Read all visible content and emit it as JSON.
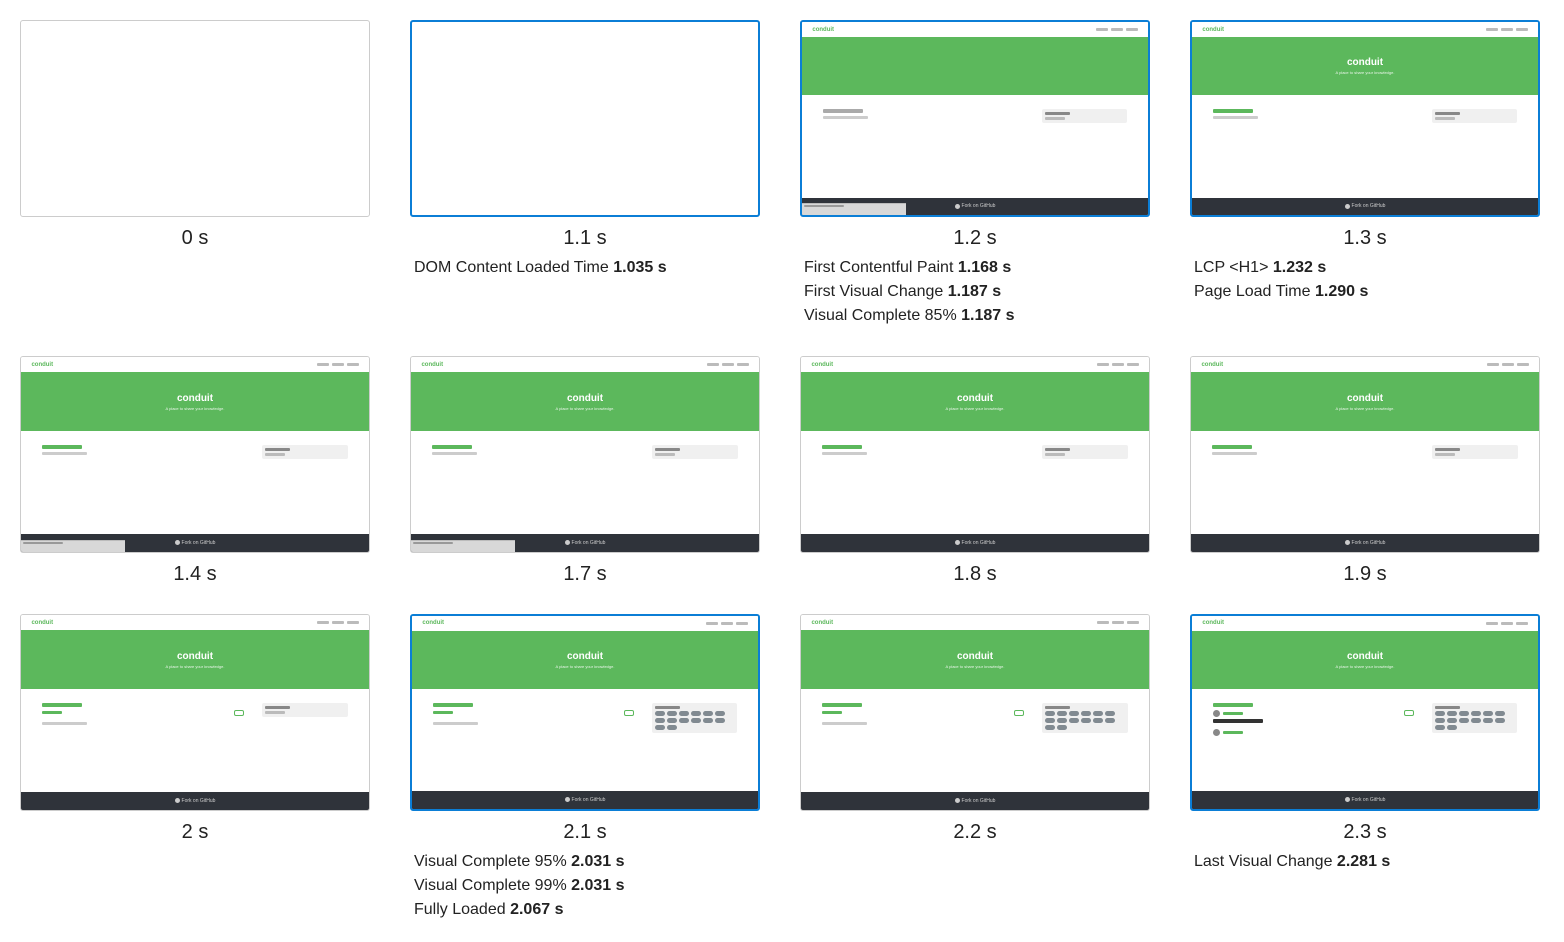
{
  "frames": [
    {
      "time": "0 s",
      "highlight": false,
      "variant": "blank",
      "metrics": []
    },
    {
      "time": "1.1 s",
      "highlight": true,
      "variant": "blank",
      "metrics": [
        {
          "label": "DOM Content Loaded Time",
          "value": "1.035 s"
        }
      ]
    },
    {
      "time": "1.2 s",
      "highlight": true,
      "variant": "partial_no_title",
      "metrics": [
        {
          "label": "First Contentful Paint",
          "value": "1.168 s"
        },
        {
          "label": "First Visual Change",
          "value": "1.187 s"
        },
        {
          "label": "Visual Complete 85%",
          "value": "1.187 s"
        }
      ]
    },
    {
      "time": "1.3 s",
      "highlight": true,
      "variant": "loading",
      "metrics": [
        {
          "label": "LCP <H1>",
          "value": "1.232 s"
        },
        {
          "label": "Page Load Time",
          "value": "1.290 s"
        }
      ]
    },
    {
      "time": "1.4 s",
      "highlight": false,
      "variant": "loading_status",
      "metrics": []
    },
    {
      "time": "1.7 s",
      "highlight": false,
      "variant": "loading_status",
      "metrics": []
    },
    {
      "time": "1.8 s",
      "highlight": false,
      "variant": "loading",
      "metrics": []
    },
    {
      "time": "1.9 s",
      "highlight": false,
      "variant": "loading",
      "metrics": []
    },
    {
      "time": "2 s",
      "highlight": false,
      "variant": "loaded_loading_tags",
      "metrics": []
    },
    {
      "time": "2.1 s",
      "highlight": true,
      "variant": "loaded_tags",
      "metrics": [
        {
          "label": "Visual Complete 95%",
          "value": "2.031 s"
        },
        {
          "label": "Visual Complete 99%",
          "value": "2.031 s"
        },
        {
          "label": "Fully Loaded",
          "value": "2.067 s"
        }
      ]
    },
    {
      "time": "2.2 s",
      "highlight": false,
      "variant": "loaded_tags",
      "metrics": []
    },
    {
      "time": "2.3 s",
      "highlight": true,
      "variant": "loaded_articles",
      "metrics": [
        {
          "label": "Last Visual Change",
          "value": "2.281 s"
        }
      ]
    }
  ],
  "thumb": {
    "logo": "conduit",
    "banner_title": "conduit",
    "banner_sub": "A place to share your knowledge.",
    "nav": [
      "Home",
      "Sign in",
      "Sign up"
    ],
    "feed_tab": "Global Feed",
    "loading_articles": "Loading articles...",
    "popular_tags": "Popular Tags",
    "loading_tags": "Loading tags...",
    "footer": "Fork on GitHub",
    "status": "Waiting for angularjs.realworld.io...",
    "article_word": "test"
  }
}
